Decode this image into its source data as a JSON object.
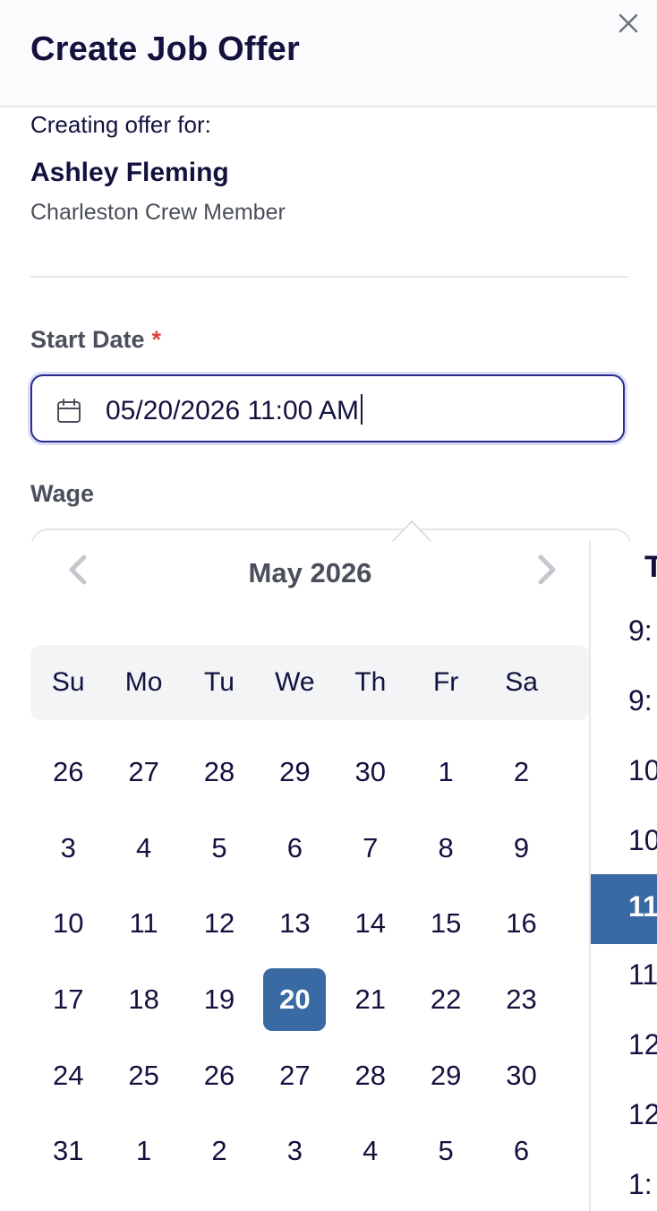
{
  "modal": {
    "title": "Create Job Offer",
    "close_icon": "close-icon"
  },
  "candidate": {
    "for_label": "Creating offer for:",
    "name": "Ashley Fleming",
    "role": "Charleston Crew Member"
  },
  "start_date": {
    "label": "Start Date",
    "required_mark": "*",
    "value": "05/20/2026 11:00 AM",
    "icon": "calendar-icon"
  },
  "wage": {
    "label": "Wage"
  },
  "datepicker": {
    "month_label": "May 2026",
    "prev_icon": "chevron-left-icon",
    "next_icon": "chevron-right-icon",
    "weekdays": [
      "Su",
      "Mo",
      "Tu",
      "We",
      "Th",
      "Fr",
      "Sa"
    ],
    "days": [
      "26",
      "27",
      "28",
      "29",
      "30",
      "1",
      "2",
      "3",
      "4",
      "5",
      "6",
      "7",
      "8",
      "9",
      "10",
      "11",
      "12",
      "13",
      "14",
      "15",
      "16",
      "17",
      "18",
      "19",
      "20",
      "21",
      "22",
      "23",
      "24",
      "25",
      "26",
      "27",
      "28",
      "29",
      "30",
      "31",
      "1",
      "2",
      "3",
      "4",
      "5",
      "6"
    ],
    "selected_day": "20",
    "time_header": "T",
    "times": [
      "9:",
      "9:",
      "10",
      "10",
      "11:",
      "11:",
      "12",
      "12",
      "1:"
    ],
    "selected_time_index": 4
  },
  "colors": {
    "primary_text": "#13123f",
    "muted_text": "#4b4f5c",
    "selected_bg": "#3a6aa4",
    "required": "#d9453a",
    "focus_border": "#2a2a8c"
  }
}
